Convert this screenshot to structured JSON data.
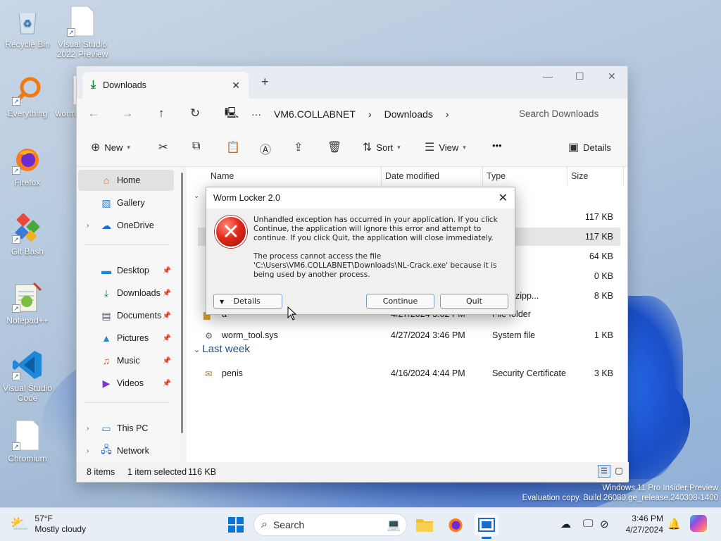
{
  "desktop": {
    "icons": [
      {
        "label": "Recycle Bin",
        "icon": "recycle-bin-icon"
      },
      {
        "label": "Visual Studio 2022 Preview",
        "icon": "file-icon"
      },
      {
        "label": "Everything",
        "icon": "search-magnifier-icon"
      },
      {
        "label": "worm",
        "icon": "file-icon"
      },
      {
        "label": "Firefox",
        "icon": "firefox-icon"
      },
      {
        "label": "Git Bash",
        "icon": "git-icon"
      },
      {
        "label": "Notepad++",
        "icon": "notepad-icon"
      },
      {
        "label": "Visual Studio Code",
        "icon": "vscode-icon"
      },
      {
        "label": "Chromium",
        "icon": "file-icon"
      }
    ]
  },
  "explorer": {
    "tab_title": "Downloads",
    "new_tab": "+",
    "window_controls": [
      "—",
      "☐",
      "✕"
    ],
    "breadcrumbs": [
      "VM6.COLLABNET",
      "Downloads"
    ],
    "search_placeholder": "Search Downloads",
    "commands": {
      "new": "New",
      "sort": "Sort",
      "view": "View",
      "more": "•••",
      "details": "Details"
    },
    "nav": {
      "home": "Home",
      "gallery": "Gallery",
      "onedrive": "OneDrive",
      "desktop": "Desktop",
      "downloads": "Downloads",
      "documents": "Documents",
      "pictures": "Pictures",
      "music": "Music",
      "videos": "Videos",
      "thispc": "This PC",
      "network": "Network"
    },
    "columns": {
      "name": "Name",
      "date": "Date modified",
      "type": "Type",
      "size": "Size"
    },
    "rows": [
      {
        "type": "ation",
        "size": "117 KB"
      },
      {
        "type": "ation",
        "size": "117 KB"
      },
      {
        "type": "e",
        "size": "64 KB"
      },
      {
        "type": "ation",
        "size": "0 KB"
      },
      {
        "type": "essed (zipp...",
        "size": "8 KB"
      },
      {
        "name": "a",
        "date": "4/27/2024 3:02 PM",
        "type": "File folder",
        "size": ""
      },
      {
        "name": "worm_tool.sys",
        "date": "4/27/2024 3:46 PM",
        "type": "System file",
        "size": "1 KB"
      },
      {
        "name": "penis",
        "date": "4/16/2024 4:44 PM",
        "type": "Security Certificate",
        "size": "3 KB"
      }
    ],
    "group_last_week": "Last week",
    "status": {
      "items": "8 items",
      "selected": "1 item selected",
      "size": "116 KB"
    }
  },
  "dialog": {
    "title": "Worm Locker 2.0",
    "message1": "Unhandled exception has occurred in your application. If you click Continue, the application will ignore this error and attempt to continue. If you click Quit, the application will close immediately.",
    "message2": "The process cannot access the file 'C:\\Users\\VM6.COLLABNET\\Downloads\\NL-Crack.exe' because it is being used by another process.",
    "details": "Details",
    "continue": "Continue",
    "quit": "Quit"
  },
  "taskbar": {
    "weather_temp": "57°F",
    "weather_desc": "Mostly cloudy",
    "search": "Search",
    "time": "3:46 PM",
    "date": "4/27/2024"
  },
  "watermark": {
    "line1": "Windows 11 Pro Insider Preview",
    "line2": "Evaluation copy. Build 26080.ge_release.240308-1400"
  }
}
